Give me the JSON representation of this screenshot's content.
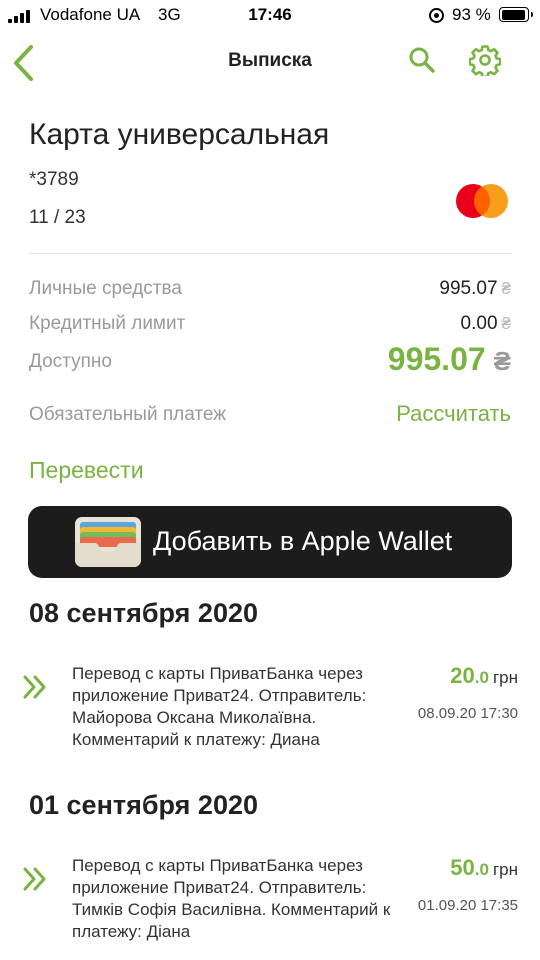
{
  "status_bar": {
    "carrier": "Vodafone UA",
    "network": "3G",
    "time": "17:46",
    "battery": "93 %"
  },
  "nav": {
    "title": "Выписка"
  },
  "card": {
    "name": "Карта универсальная",
    "number": "*3789",
    "expiry": "11 / 23",
    "brand_icon": "mastercard-icon"
  },
  "balances": {
    "own_funds": {
      "label": "Личные средства",
      "value": "995.07"
    },
    "credit_limit": {
      "label": "Кредитный лимит",
      "value": "0.00"
    },
    "available": {
      "label": "Доступно",
      "value": "995.07"
    },
    "currency_symbol": "₴"
  },
  "mandatory_payment": {
    "label": "Обязательный платеж",
    "action": "Рассчитать"
  },
  "transfer_label": "Перевести",
  "wallet_button": {
    "label": "Добавить в Apple Wallet"
  },
  "groups": [
    {
      "date": "08 сентября 2020",
      "transactions": [
        {
          "description": "Перевод с карты ПриватБанка через приложение Приват24. Отправитель: Майорова Оксана Миколаївна. Комментарий к платежу: Диана",
          "amount_int": "20",
          "amount_dec": ".0",
          "currency": "грн",
          "datetime": "08.09.20 17:30"
        }
      ]
    },
    {
      "date": "01 сентября 2020",
      "transactions": [
        {
          "description": "Перевод с карты ПриватБанка через приложение Приват24. Отправитель: Тимків Софія Василівна. Комментарий к платежу: Діана",
          "amount_int": "50",
          "amount_dec": ".0",
          "currency": "грн",
          "datetime": "01.09.20 17:35"
        }
      ]
    }
  ],
  "colors": {
    "accent": "#79b443",
    "wallet_bg": "#1c1c1c",
    "label_grey": "#9a9a9a"
  }
}
